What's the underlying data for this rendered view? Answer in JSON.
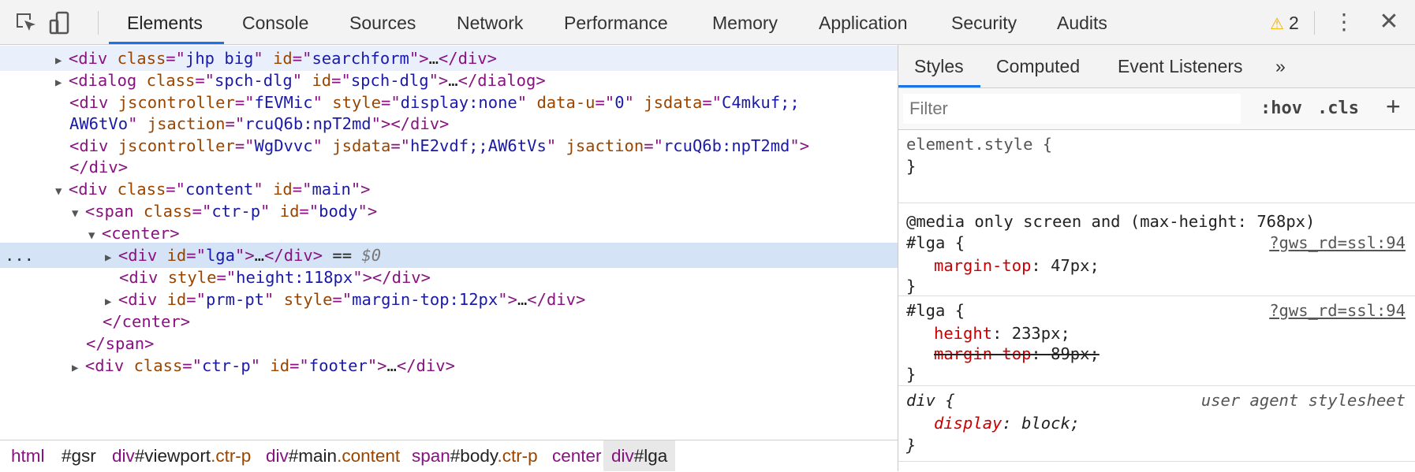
{
  "toolbar": {
    "tabs": [
      "Elements",
      "Console",
      "Sources",
      "Network",
      "Performance",
      "Memory",
      "Application",
      "Security",
      "Audits"
    ],
    "warning_count": "2"
  },
  "dom": {
    "lines": [
      {
        "seg": [
          [
            "tri",
            "▶"
          ],
          [
            "tag",
            "<div "
          ],
          [
            "attr",
            "class"
          ],
          [
            "tag",
            "=\""
          ],
          [
            "val",
            "jhp big"
          ],
          [
            "tag",
            "\" "
          ],
          [
            "attr",
            "id"
          ],
          [
            "tag",
            "=\""
          ],
          [
            "val",
            "searchform"
          ],
          [
            "tag",
            "\">"
          ],
          [
            "txt",
            "…"
          ],
          [
            "tag",
            "</div>"
          ]
        ]
      },
      {
        "seg": [
          [
            "tri",
            "▶"
          ],
          [
            "tag",
            "<dialog "
          ],
          [
            "attr",
            "class"
          ],
          [
            "tag",
            "=\""
          ],
          [
            "val",
            "spch-dlg"
          ],
          [
            "tag",
            "\" "
          ],
          [
            "attr",
            "id"
          ],
          [
            "tag",
            "=\""
          ],
          [
            "val",
            "spch-dlg"
          ],
          [
            "tag",
            "\">"
          ],
          [
            "txt",
            "…"
          ],
          [
            "tag",
            "</dialog>"
          ]
        ]
      },
      {
        "seg": [
          [
            "tag",
            "<div "
          ],
          [
            "attr",
            "jscontroller"
          ],
          [
            "tag",
            "=\""
          ],
          [
            "val",
            "fEVMic"
          ],
          [
            "tag",
            "\" "
          ],
          [
            "attr",
            "style"
          ],
          [
            "tag",
            "=\""
          ],
          [
            "val",
            "display:none"
          ],
          [
            "tag",
            "\" "
          ],
          [
            "attr",
            "data-u"
          ],
          [
            "tag",
            "=\""
          ],
          [
            "val",
            "0"
          ],
          [
            "tag",
            "\" "
          ],
          [
            "attr",
            "jsdata"
          ],
          [
            "tag",
            "=\""
          ],
          [
            "val",
            "C4mkuf;;"
          ]
        ]
      },
      {
        "seg": [
          [
            "val",
            "AW6tVo"
          ],
          [
            "tag",
            "\" "
          ],
          [
            "attr",
            "jsaction"
          ],
          [
            "tag",
            "=\""
          ],
          [
            "val",
            "rcuQ6b:npT2md"
          ],
          [
            "tag",
            "\"></div>"
          ]
        ]
      },
      {
        "seg": [
          [
            "tag",
            "<div "
          ],
          [
            "attr",
            "jscontroller"
          ],
          [
            "tag",
            "=\""
          ],
          [
            "val",
            "WgDvvc"
          ],
          [
            "tag",
            "\" "
          ],
          [
            "attr",
            "jsdata"
          ],
          [
            "tag",
            "=\""
          ],
          [
            "val",
            "hE2vdf;;AW6tVs"
          ],
          [
            "tag",
            "\" "
          ],
          [
            "attr",
            "jsaction"
          ],
          [
            "tag",
            "=\""
          ],
          [
            "val",
            "rcuQ6b:npT2md"
          ],
          [
            "tag",
            "\">"
          ]
        ]
      },
      {
        "seg": [
          [
            "tag",
            "</div>"
          ]
        ]
      },
      {
        "seg": [
          [
            "tri",
            "▼"
          ],
          [
            "tag",
            "<div "
          ],
          [
            "attr",
            "class"
          ],
          [
            "tag",
            "=\""
          ],
          [
            "val",
            "content"
          ],
          [
            "tag",
            "\" "
          ],
          [
            "attr",
            "id"
          ],
          [
            "tag",
            "=\""
          ],
          [
            "val",
            "main"
          ],
          [
            "tag",
            "\">"
          ]
        ]
      },
      {
        "seg": [
          [
            "tri",
            "▼"
          ],
          [
            "tag",
            "<span "
          ],
          [
            "attr",
            "class"
          ],
          [
            "tag",
            "=\""
          ],
          [
            "val",
            "ctr-p"
          ],
          [
            "tag",
            "\" "
          ],
          [
            "attr",
            "id"
          ],
          [
            "tag",
            "=\""
          ],
          [
            "val",
            "body"
          ],
          [
            "tag",
            "\">"
          ]
        ]
      },
      {
        "seg": [
          [
            "tri",
            "▼"
          ],
          [
            "tag",
            "<center>"
          ]
        ]
      },
      {
        "seg": [
          [
            "tri",
            "▶"
          ],
          [
            "tag",
            "<div "
          ],
          [
            "attr",
            "id"
          ],
          [
            "tag",
            "=\""
          ],
          [
            "val",
            "lga"
          ],
          [
            "tag",
            "\">"
          ],
          [
            "txt",
            "…"
          ],
          [
            "tag",
            "</div>"
          ],
          [
            "txt",
            " == "
          ],
          [
            "dollar",
            "$0"
          ]
        ]
      },
      {
        "seg": [
          [
            "tag",
            "<div "
          ],
          [
            "attr",
            "style"
          ],
          [
            "tag",
            "=\""
          ],
          [
            "val",
            "height:118px"
          ],
          [
            "tag",
            "\"></div>"
          ]
        ]
      },
      {
        "seg": [
          [
            "tri",
            "▶"
          ],
          [
            "tag",
            "<div "
          ],
          [
            "attr",
            "id"
          ],
          [
            "tag",
            "=\""
          ],
          [
            "val",
            "prm-pt"
          ],
          [
            "tag",
            "\" "
          ],
          [
            "attr",
            "style"
          ],
          [
            "tag",
            "=\""
          ],
          [
            "val",
            "margin-top:12px"
          ],
          [
            "tag",
            "\">"
          ],
          [
            "txt",
            "…"
          ],
          [
            "tag",
            "</div>"
          ]
        ]
      },
      {
        "seg": [
          [
            "tag",
            "</center>"
          ]
        ]
      },
      {
        "seg": [
          [
            "tag",
            "</span>"
          ]
        ]
      },
      {
        "seg": [
          [
            "tri",
            "▶"
          ],
          [
            "tag",
            "<div "
          ],
          [
            "attr",
            "class"
          ],
          [
            "tag",
            "=\""
          ],
          [
            "val",
            "ctr-p"
          ],
          [
            "tag",
            "\" "
          ],
          [
            "attr",
            "id"
          ],
          [
            "tag",
            "=\""
          ],
          [
            "val",
            "footer"
          ],
          [
            "tag",
            "\">"
          ],
          [
            "txt",
            "…"
          ],
          [
            "tag",
            "</div>"
          ]
        ]
      }
    ],
    "selected_marker": "..."
  },
  "breadcrumb": [
    {
      "tag": "html",
      "id": "",
      "cls": ""
    },
    {
      "tag": "",
      "id": "#gsr",
      "cls": ""
    },
    {
      "tag": "div",
      "id": "#viewport",
      "cls": ".ctr-p"
    },
    {
      "tag": "div",
      "id": "#main",
      "cls": ".content"
    },
    {
      "tag": "span",
      "id": "#body",
      "cls": ".ctr-p"
    },
    {
      "tag": "center",
      "id": "",
      "cls": ""
    },
    {
      "tag": "div",
      "id": "#lga",
      "cls": ""
    }
  ],
  "styles": {
    "tabs": [
      "Styles",
      "Computed",
      "Event Listeners",
      "»"
    ],
    "filter_placeholder": "Filter",
    "hov": ":hov",
    "cls": ".cls",
    "plus": "+",
    "element_style": "element.style {",
    "close_brace": "}",
    "media": "@media only screen and (max-height: 768px)",
    "rule1": {
      "selector": "#lga {",
      "source": "?gws_rd=ssl:94",
      "prop": "margin-top",
      "value": "47px;"
    },
    "rule2": {
      "selector": "#lga {",
      "source": "?gws_rd=ssl:94",
      "prop1": "height",
      "value1": "233px;",
      "prop2": "margin-top",
      "value2": "89px;"
    },
    "rule3": {
      "selector": "div {",
      "source": "user agent stylesheet",
      "prop": "display",
      "value": "block;"
    }
  },
  "colors": {
    "accent": "#1a73e8",
    "tag": "#881280",
    "attr": "#994500",
    "value": "#1a1aa6",
    "prop": "#c80000"
  }
}
